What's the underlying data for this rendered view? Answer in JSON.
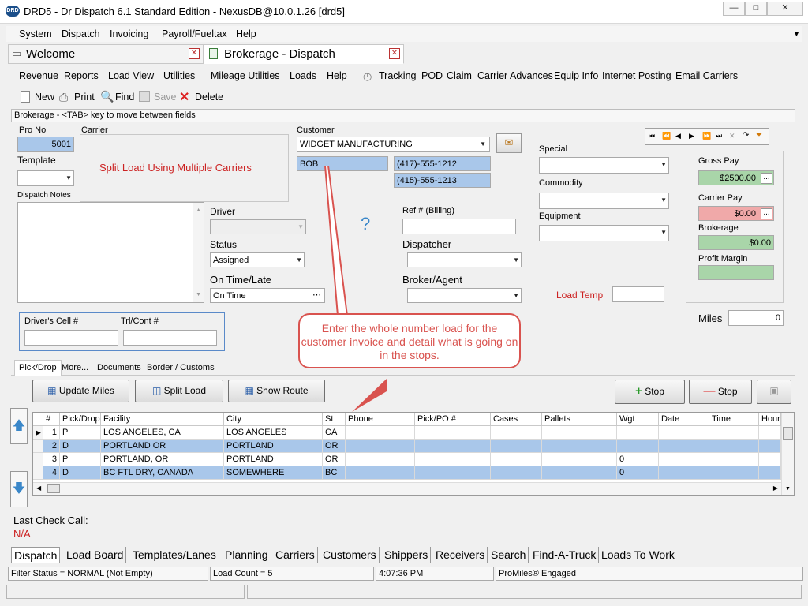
{
  "window": {
    "title": "DRD5 - Dr Dispatch 6.1 Standard Edition - NexusDB@10.0.1.26 [drd5]",
    "icon_text": "DRD"
  },
  "menu": [
    "System",
    "Dispatch",
    "Invoicing",
    "Payroll/Fueltax",
    "Help"
  ],
  "doc_tabs": [
    {
      "label": "Welcome",
      "active": false
    },
    {
      "label": "Brokerage - Dispatch",
      "active": true
    }
  ],
  "submenu": [
    "Revenue",
    "Reports",
    "Load View",
    "Utilities",
    "Mileage Utilities",
    "Loads",
    "Help",
    "Tracking",
    "POD",
    "Claim",
    "Carrier Advances",
    "Equip Info",
    "Internet Posting",
    "Email Carriers"
  ],
  "toolbar": {
    "new": "New",
    "print": "Print",
    "find": "Find",
    "save": "Save",
    "delete": "Delete"
  },
  "hint": "Brokerage - <TAB> key to move between fields",
  "form": {
    "pro_no_label": "Pro No",
    "pro_no": "5001",
    "carrier_label": "Carrier",
    "carrier_text": "Split Load Using Multiple Carriers",
    "template_label": "Template",
    "dispatch_notes_label": "Dispatch Notes",
    "customer_label": "Customer",
    "customer": "WIDGET MANUFACTURING",
    "contact": "BOB",
    "phone1": "(417)-555-1212",
    "phone2": "(415)-555-1213",
    "driver_label": "Driver",
    "status_label": "Status",
    "status": "Assigned",
    "ontime_label": "On Time/Late",
    "ontime": "On Time",
    "ref_label": "Ref # (Billing)",
    "dispatcher_label": "Dispatcher",
    "broker_label": "Broker/Agent",
    "special_label": "Special",
    "commodity_label": "Commodity",
    "equipment_label": "Equipment",
    "load_temp_label": "Load Temp",
    "drivers_cell_label": "Driver's Cell #",
    "trl_label": "Trl/Cont #",
    "miles_label": "Miles",
    "miles": "0",
    "help_mark": "?"
  },
  "pay": {
    "gross_label": "Gross Pay",
    "gross": "$2500.00",
    "carrier_label": "Carrier Pay",
    "carrier": "$0.00",
    "brokerage_label": "Brokerage",
    "brokerage": "$0.00",
    "margin_label": "Profit Margin",
    "ellipsis": "..."
  },
  "nav_buttons": [
    "⏮",
    "⏪",
    "◀",
    "▶",
    "⏩",
    "⏭",
    "✕",
    "↷",
    "⏷"
  ],
  "callout": "Enter the whole number load for the customer invoice and detail what is going on in the stops.",
  "stop_tabs": [
    "Pick/Drop",
    "More...",
    "Documents",
    "Border / Customs"
  ],
  "stop_buttons": {
    "update_miles": "Update Miles",
    "split_load": "Split Load",
    "show_route": "Show Route",
    "add_stop": "Stop",
    "remove_stop": "Stop"
  },
  "grid": {
    "headers": [
      "#",
      "Pick/Drop",
      "Facility",
      "City",
      "St",
      "Phone",
      "Pick/PO #",
      "Cases",
      "Pallets",
      "Wgt",
      "Date",
      "Time",
      "Hour"
    ],
    "rows": [
      [
        "1",
        "P",
        "LOS ANGELES, CA",
        "LOS ANGELES",
        "CA",
        "",
        "",
        "",
        "",
        "",
        "",
        "",
        ""
      ],
      [
        "2",
        "D",
        "PORTLAND OR",
        "PORTLAND",
        "OR",
        "",
        "",
        "",
        "",
        "",
        "",
        "",
        ""
      ],
      [
        "3",
        "P",
        "PORTLAND, OR",
        "PORTLAND",
        "OR",
        "",
        "",
        "",
        "",
        "0",
        "",
        "",
        ""
      ],
      [
        "4",
        "D",
        "BC FTL DRY, CANADA",
        "SOMEWHERE",
        "BC",
        "",
        "",
        "",
        "",
        "0",
        "",
        "",
        ""
      ]
    ]
  },
  "last_check": {
    "label": "Last Check Call:",
    "value": "N/A"
  },
  "bottom_tabs": [
    "Dispatch",
    "Load Board",
    "Templates/Lanes",
    "Planning",
    "Carriers",
    "Customers",
    "Shippers",
    "Receivers",
    "Search",
    "Find-A-Truck",
    "Loads To Work"
  ],
  "status": {
    "filter": "Filter Status = NORMAL (Not Empty)",
    "count": "Load Count = 5",
    "time": "4:07:36 PM",
    "promiles": "ProMiles® Engaged"
  },
  "colors": {
    "callout": "#d9534f",
    "selected_row": "#a9c7ea",
    "link_red": "#cc2222"
  }
}
